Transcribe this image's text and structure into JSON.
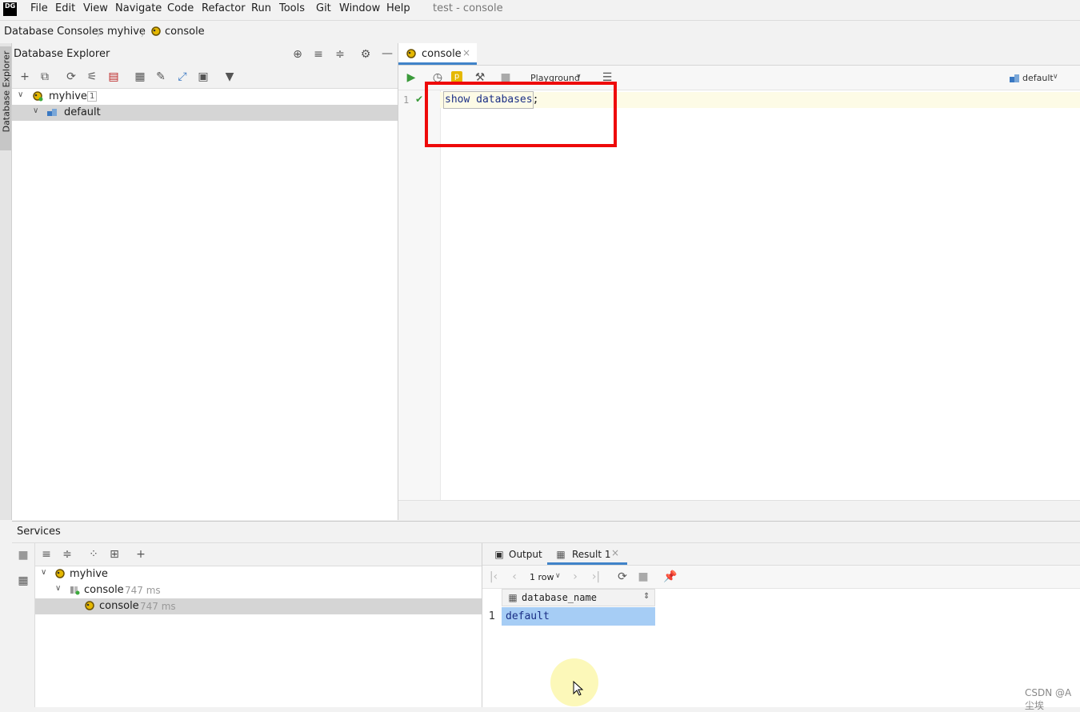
{
  "menu": {
    "logo": "DG",
    "items": [
      "File",
      "Edit",
      "View",
      "Navigate",
      "Code",
      "Refactor",
      "Run",
      "Tools",
      "Git",
      "Window",
      "Help"
    ],
    "title": "test - console"
  },
  "breadcrumb": [
    "Database Consoles",
    "myhive",
    "console"
  ],
  "sidebar_strip_label": "Database Explorer",
  "explorer": {
    "title": "Database Explorer",
    "tree": [
      {
        "label": "myhive",
        "badge": "1"
      },
      {
        "label": "default"
      }
    ]
  },
  "editor": {
    "tab_label": "console",
    "playground_label": "Playground",
    "schema_label": "default",
    "line_number": "1",
    "code_keyword": "show databases",
    "code_end": ";"
  },
  "services": {
    "title": "Services",
    "tree": [
      {
        "label": "myhive"
      },
      {
        "label": "console",
        "time": "747 ms"
      },
      {
        "label": "console",
        "time": "747 ms"
      }
    ]
  },
  "result": {
    "tabs": [
      "Output",
      "Result 1"
    ],
    "rows_label": "1 row",
    "columns": [
      "database_name"
    ],
    "rows": [
      {
        "num": "1",
        "values": [
          "default"
        ]
      }
    ]
  },
  "watermark": "CSDN @A尘埃",
  "colors": {
    "accent": "#4083c9",
    "highlight_box": "#ee0a0a",
    "selected_cell": "#a6cdf5"
  }
}
